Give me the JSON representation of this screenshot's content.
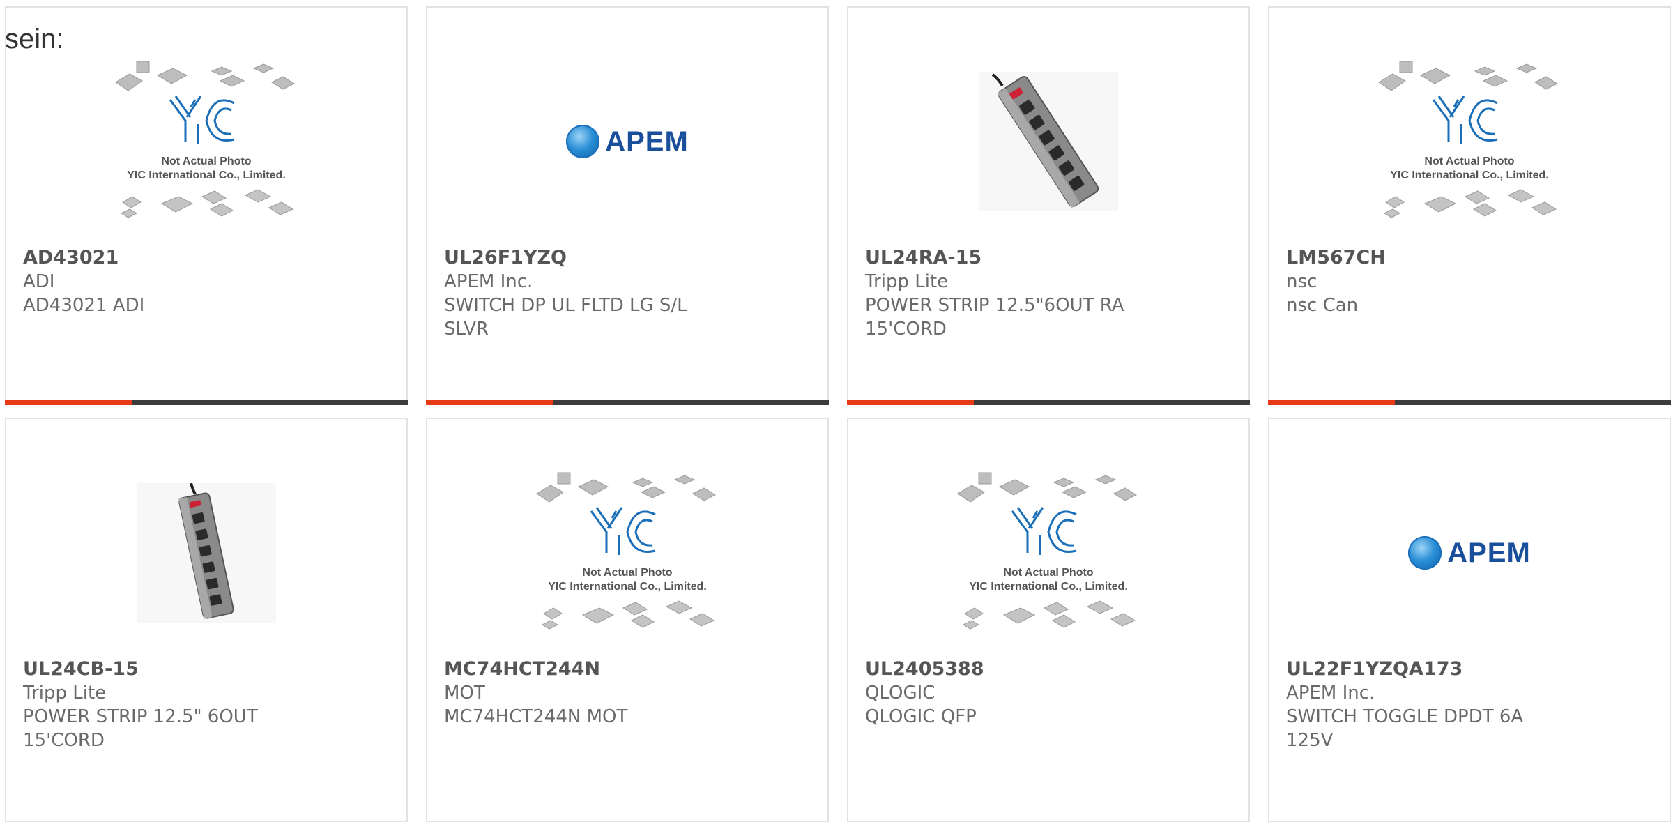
{
  "heading_fragment": "sein:",
  "colors": {
    "accent": "#e83a17",
    "bar_dark": "#3c3c3c",
    "card_border": "#e2e2e2",
    "text": "#6a6a6a",
    "apem_blue": "#1a4f9c"
  },
  "placeholder_image": {
    "line1": "Not Actual Photo",
    "line2": "YIC International Co., Limited."
  },
  "products": [
    {
      "part_number": "AD43021",
      "manufacturer": "ADI",
      "description": "AD43021 ADI",
      "image": "yic-placeholder"
    },
    {
      "part_number": "UL26F1YZQ",
      "manufacturer": "APEM Inc.",
      "description": "SWITCH DP UL FLTD LG S/L SLVR",
      "image": "apem-logo",
      "logo_text": "APEM"
    },
    {
      "part_number": "UL24RA-15",
      "manufacturer": "Tripp Lite",
      "description": "POWER STRIP 12.5\"6OUT RA 15'CORD",
      "image": "power-strip-diagonal"
    },
    {
      "part_number": "LM567CH",
      "manufacturer": "nsc",
      "description": "nsc Can",
      "image": "yic-placeholder"
    },
    {
      "part_number": "UL24CB-15",
      "manufacturer": "Tripp Lite",
      "description": "POWER STRIP 12.5\" 6OUT 15'CORD",
      "image": "power-strip-vertical"
    },
    {
      "part_number": "MC74HCT244N",
      "manufacturer": "MOT",
      "description": "MC74HCT244N MOT",
      "image": "yic-placeholder"
    },
    {
      "part_number": "UL2405388",
      "manufacturer": "QLOGIC",
      "description": "QLOGIC QFP",
      "image": "yic-placeholder"
    },
    {
      "part_number": "UL22F1YZQA173",
      "manufacturer": "APEM Inc.",
      "description": "SWITCH TOGGLE DPDT 6A 125V",
      "image": "apem-logo",
      "logo_text": "APEM"
    }
  ]
}
